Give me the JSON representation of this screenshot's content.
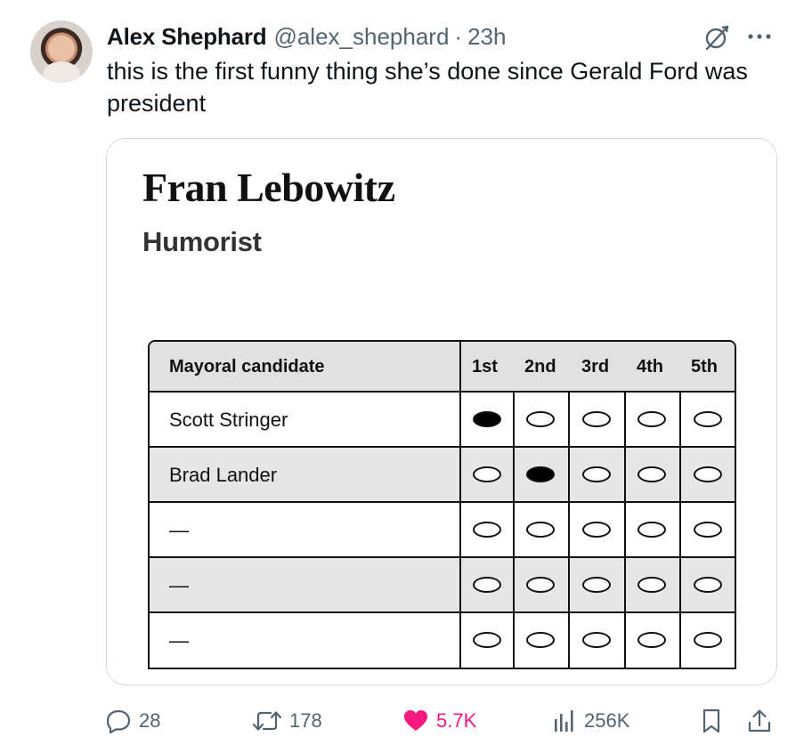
{
  "tweet": {
    "author_name": "Alex Shephard",
    "handle": "@alex_shephard",
    "separator": "·",
    "time": "23h",
    "text": "this is the first funny thing she’s done since Gerald Ford was president"
  },
  "card": {
    "title": "Fran Lebowitz",
    "subtitle": "Humorist",
    "ballot": {
      "header_label": "Mayoral candidate",
      "rank_labels": [
        "1st",
        "2nd",
        "3rd",
        "4th",
        "5th"
      ],
      "rows": [
        {
          "name": "Scott Stringer",
          "selected_rank": 1
        },
        {
          "name": "Brad Lander",
          "selected_rank": 2
        },
        {
          "name": "—",
          "selected_rank": null
        },
        {
          "name": "—",
          "selected_rank": null
        },
        {
          "name": "—",
          "selected_rank": null
        }
      ]
    }
  },
  "actions": {
    "replies": "28",
    "reposts": "178",
    "likes": "5.7K",
    "views": "256K"
  },
  "icons": {
    "grok": "grok-icon",
    "more": "more-icon",
    "reply": "reply-icon",
    "repost": "repost-icon",
    "like": "heart-icon",
    "views": "views-icon",
    "bookmark": "bookmark-icon",
    "share": "share-icon"
  },
  "colors": {
    "like_active": "#f91880",
    "secondary_text": "#536471",
    "border": "#cfd9de"
  }
}
